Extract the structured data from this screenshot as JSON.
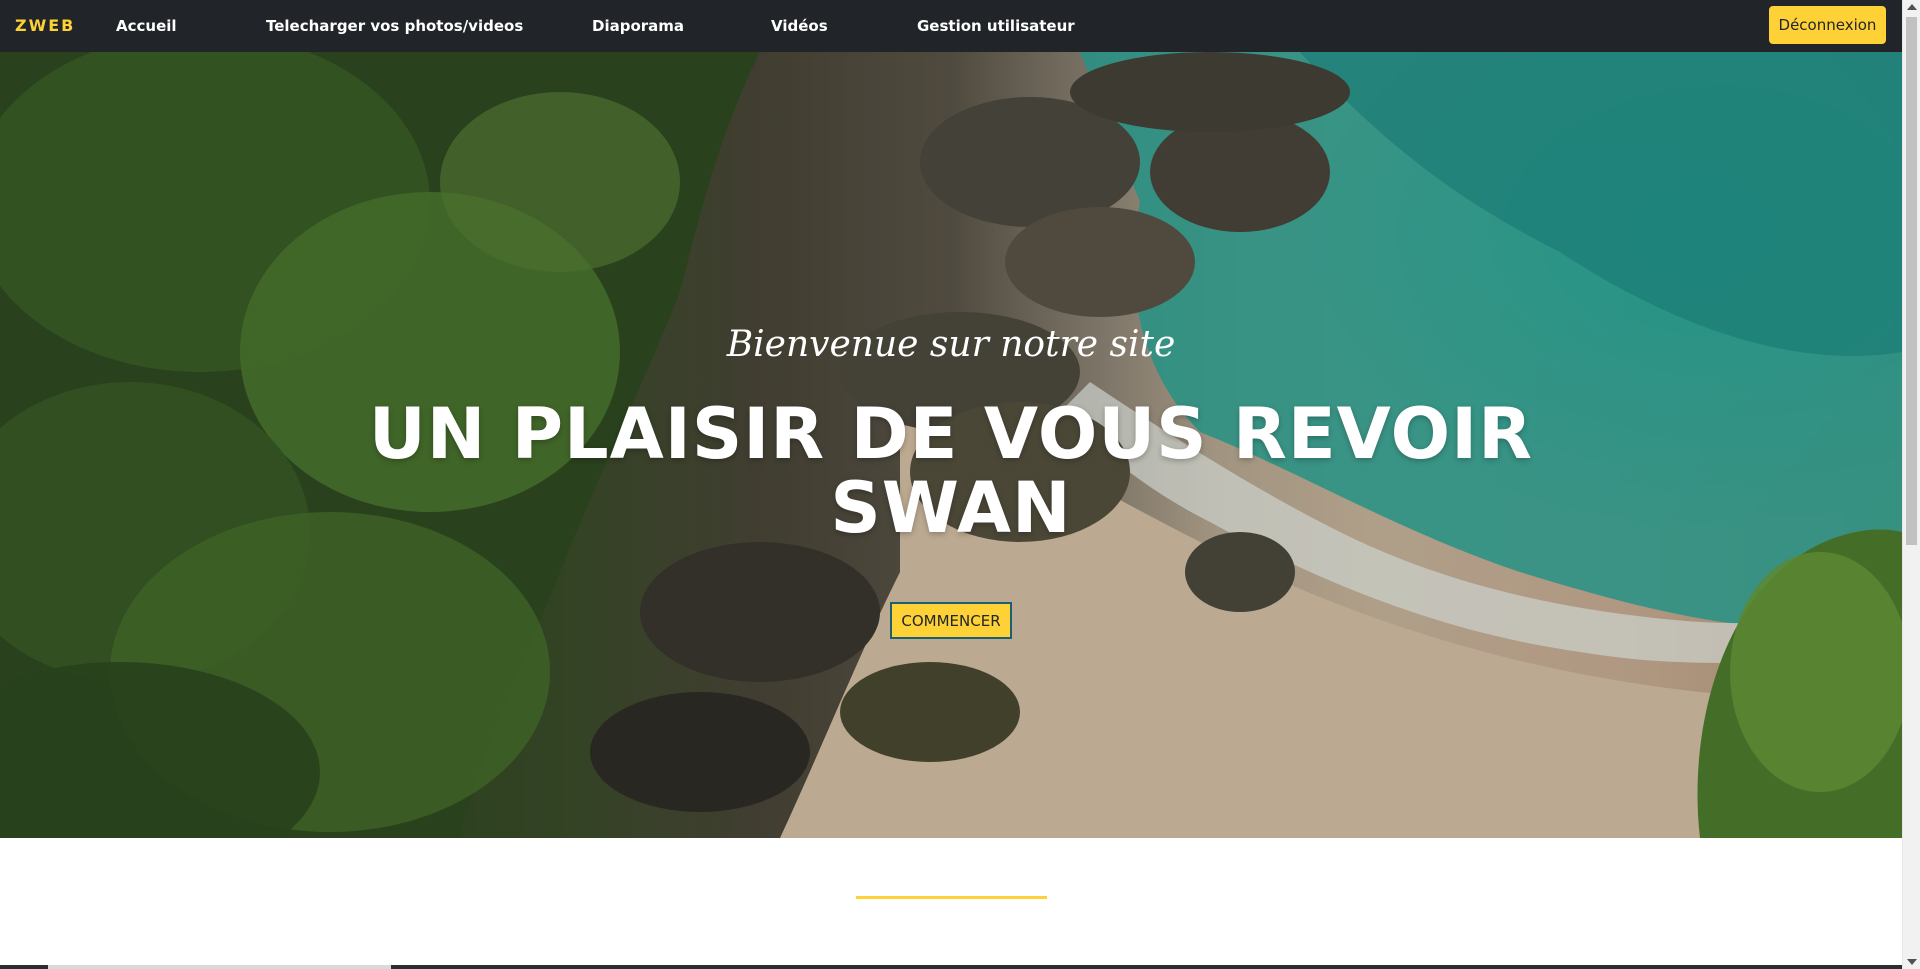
{
  "navbar": {
    "brand": "ZWEB",
    "links": {
      "accueil": "Accueil",
      "upload": "Telecharger vos photos/videos",
      "diaporama": "Diaporama",
      "videos": "Vidéos",
      "gestion": "Gestion utilisateur"
    },
    "logout_label": "Déconnexion"
  },
  "hero": {
    "subtitle": "Bienvenue sur notre site",
    "title_line1": "UN PLAISIR DE VOUS REVOIR",
    "title_line2": "SWAN",
    "button_label": "COMMENCER",
    "background_image": "aerial-beach-cliff-photo"
  },
  "colors": {
    "accent": "#fed136",
    "navbar_bg": "#212529",
    "text_light": "#ffffff"
  },
  "icons": {
    "scroll_up": "scroll-up-arrow-icon",
    "scroll_down": "scroll-down-arrow-icon"
  }
}
